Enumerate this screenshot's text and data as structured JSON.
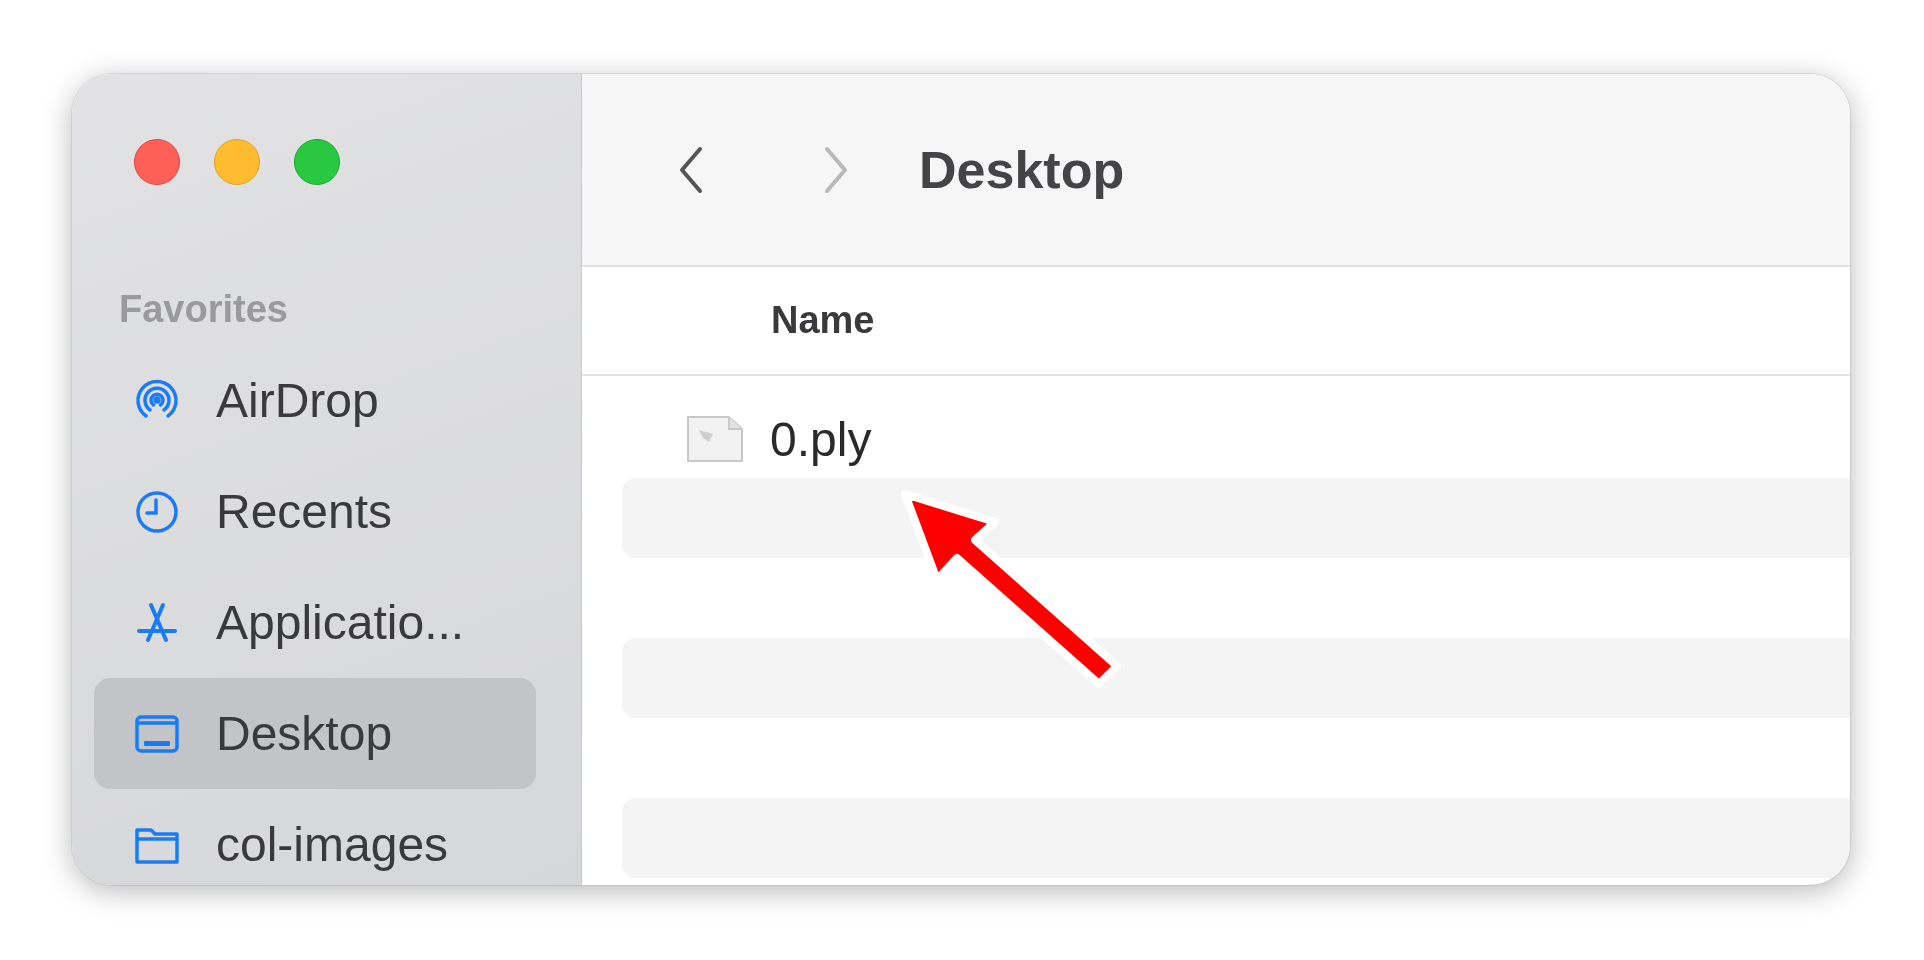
{
  "window": {
    "title": "Desktop"
  },
  "toolbar": {
    "back": {
      "disabled": false
    },
    "forward": {
      "disabled": true
    }
  },
  "sidebar": {
    "heading": "Favorites",
    "items": [
      {
        "kind": "airdrop",
        "label": "AirDrop",
        "selected": false
      },
      {
        "kind": "clock",
        "label": "Recents",
        "selected": false
      },
      {
        "kind": "apps",
        "label": "Applicatio...",
        "selected": false
      },
      {
        "kind": "desktop",
        "label": "Desktop",
        "selected": true
      },
      {
        "kind": "folder",
        "label": "col-images",
        "selected": false
      }
    ]
  },
  "table": {
    "columns": [
      "Name"
    ],
    "rows": [
      {
        "name": "0.ply"
      }
    ]
  }
}
